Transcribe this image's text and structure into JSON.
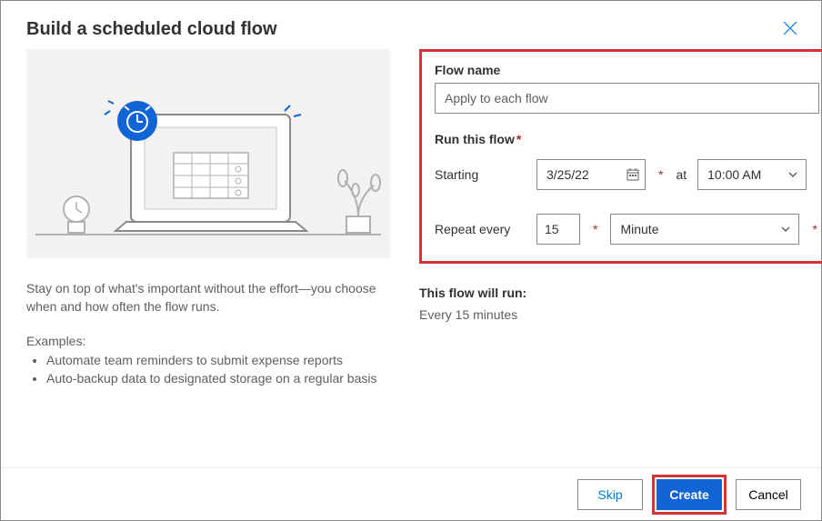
{
  "dialog": {
    "title": "Build a scheduled cloud flow"
  },
  "left": {
    "description": "Stay on top of what's important without the effort—you choose when and how often the flow runs.",
    "examples_label": "Examples:",
    "examples": [
      "Automate team reminders to submit expense reports",
      "Auto-backup data to designated storage on a regular basis"
    ]
  },
  "form": {
    "name_label": "Flow name",
    "name_value": "Apply to each flow",
    "run_label": "Run this flow",
    "starting_label": "Starting",
    "starting_date": "3/25/22",
    "at_label": "at",
    "starting_time": "10:00 AM",
    "repeat_label": "Repeat every",
    "repeat_value": "15",
    "repeat_unit": "Minute"
  },
  "summary": {
    "label": "This flow will run:",
    "text": "Every 15 minutes"
  },
  "buttons": {
    "skip": "Skip",
    "create": "Create",
    "cancel": "Cancel"
  }
}
